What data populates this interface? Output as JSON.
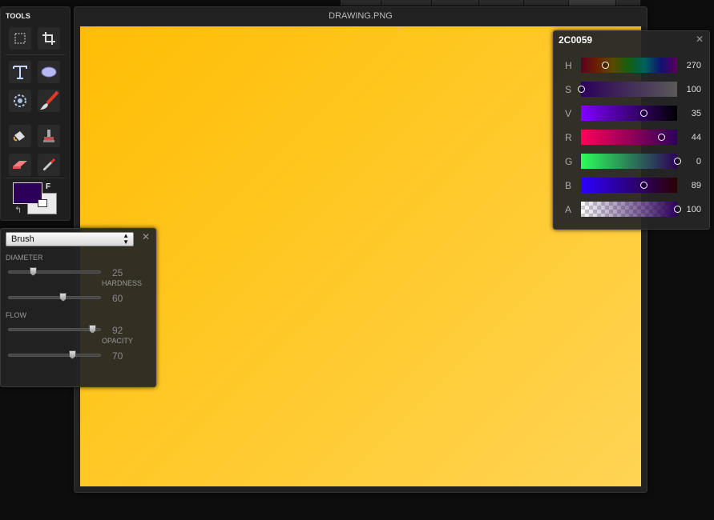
{
  "document": {
    "title": "DRAWING.PNG"
  },
  "tools": {
    "title": "TOOLS",
    "items": [
      {
        "name": "marquee-tool",
        "icon": "dashed-rectangle-icon"
      },
      {
        "name": "crop-tool",
        "icon": "crop-icon"
      },
      {
        "name": "text-tool",
        "icon": "text-t-icon"
      },
      {
        "name": "ellipse-tool",
        "icon": "ellipse-icon"
      },
      {
        "name": "pattern-tool",
        "icon": "gear-flower-icon"
      },
      {
        "name": "brush-tool",
        "icon": "paintbrush-icon"
      },
      {
        "name": "fill-tool",
        "icon": "paint-bucket-icon"
      },
      {
        "name": "stamp-tool",
        "icon": "clone-stamp-icon"
      },
      {
        "name": "eraser-tool",
        "icon": "eraser-icon"
      },
      {
        "name": "eyedropper-tool",
        "icon": "eyedropper-icon"
      }
    ],
    "foreground_label": "F",
    "foreground_color": "#2C0059",
    "background_color": "#EAEAEA"
  },
  "brush_panel": {
    "selected": "Brush",
    "sliders": [
      {
        "label": "DIAMETER",
        "value": "25",
        "fraction": 0.27
      },
      {
        "label": "HARDNESS",
        "value": "60",
        "fraction": 0.6
      },
      {
        "label": "FLOW",
        "value": "92",
        "fraction": 0.92
      },
      {
        "label": "OPACITY",
        "value": "70",
        "fraction": 0.7
      }
    ]
  },
  "color_panel": {
    "hex": "2C0059",
    "channels": [
      {
        "label": "H",
        "value": "270",
        "fraction": 0.25
      },
      {
        "label": "S",
        "value": "100",
        "fraction": 0.0
      },
      {
        "label": "V",
        "value": "35",
        "fraction": 0.65
      },
      {
        "label": "R",
        "value": "44",
        "fraction": 0.83
      },
      {
        "label": "G",
        "value": "0",
        "fraction": 1.0
      },
      {
        "label": "B",
        "value": "89",
        "fraction": 0.65
      },
      {
        "label": "A",
        "value": "100",
        "fraction": 1.0
      }
    ]
  }
}
